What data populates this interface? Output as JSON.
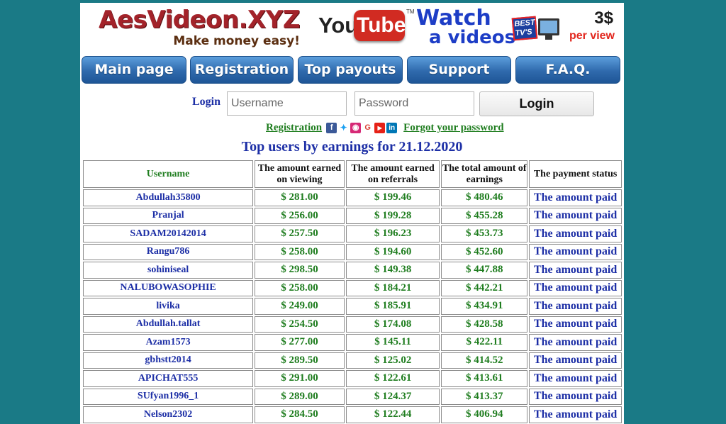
{
  "header": {
    "logo_title": "AesVideon.XYZ",
    "logo_tagline": "Make money easy!",
    "banner": {
      "yt_you": "You",
      "yt_tube": "Tube",
      "yt_tm": "TM",
      "watch_line1": "Watch",
      "watch_line2": "a videos",
      "best_badge": "BEST\nTV'S",
      "price_amount": "3$",
      "price_label": "per view"
    }
  },
  "nav": {
    "items": [
      {
        "label": "Main page"
      },
      {
        "label": "Registration"
      },
      {
        "label": "Top payouts"
      },
      {
        "label": "Support"
      },
      {
        "label": "F.A.Q."
      }
    ]
  },
  "login": {
    "label": "Login",
    "username_placeholder": "Username",
    "password_placeholder": "Password",
    "button_label": "Login",
    "registration_link": "Registration",
    "forgot_link": "Forgot your password",
    "social_icons": [
      "facebook-icon",
      "twitter-icon",
      "instagram-icon",
      "google-icon",
      "youtube-icon",
      "linkedin-icon"
    ]
  },
  "top_title": "Top users by earnings for 21.12.2020",
  "table": {
    "headers": {
      "username": "Username",
      "viewing": "The amount earned on viewing",
      "referrals": "The amount earned on referrals",
      "total": "The total amount of earnings",
      "status": "The payment status"
    },
    "rows": [
      {
        "username": "Abdullah35800",
        "viewing": "$ 281.00",
        "referrals": "$ 199.46",
        "total": "$ 480.46",
        "status": "The amount paid"
      },
      {
        "username": "Pranjal",
        "viewing": "$ 256.00",
        "referrals": "$ 199.28",
        "total": "$ 455.28",
        "status": "The amount paid"
      },
      {
        "username": "SADAM20142014",
        "viewing": "$ 257.50",
        "referrals": "$ 196.23",
        "total": "$ 453.73",
        "status": "The amount paid"
      },
      {
        "username": "Rangu786",
        "viewing": "$ 258.00",
        "referrals": "$ 194.60",
        "total": "$ 452.60",
        "status": "The amount paid"
      },
      {
        "username": "sohiniseal",
        "viewing": "$ 298.50",
        "referrals": "$ 149.38",
        "total": "$ 447.88",
        "status": "The amount paid"
      },
      {
        "username": "NALUBOWASOPHIE",
        "viewing": "$ 258.00",
        "referrals": "$ 184.21",
        "total": "$ 442.21",
        "status": "The amount paid"
      },
      {
        "username": "livika",
        "viewing": "$ 249.00",
        "referrals": "$ 185.91",
        "total": "$ 434.91",
        "status": "The amount paid"
      },
      {
        "username": "Abdullah.tallat",
        "viewing": "$ 254.50",
        "referrals": "$ 174.08",
        "total": "$ 428.58",
        "status": "The amount paid"
      },
      {
        "username": "Azam1573",
        "viewing": "$ 277.00",
        "referrals": "$ 145.11",
        "total": "$ 422.11",
        "status": "The amount paid"
      },
      {
        "username": "gbhstt2014",
        "viewing": "$ 289.50",
        "referrals": "$ 125.02",
        "total": "$ 414.52",
        "status": "The amount paid"
      },
      {
        "username": "APICHAT555",
        "viewing": "$ 291.00",
        "referrals": "$ 122.61",
        "total": "$ 413.61",
        "status": "The amount paid"
      },
      {
        "username": "SUfyan1996_1",
        "viewing": "$ 289.00",
        "referrals": "$ 124.37",
        "total": "$ 413.37",
        "status": "The amount paid"
      },
      {
        "username": "Nelson2302",
        "viewing": "$ 284.50",
        "referrals": "$ 122.44",
        "total": "$ 406.94",
        "status": "The amount paid"
      }
    ]
  },
  "colors": {
    "background": "#1a7a86",
    "nav_button": "#2f6aad",
    "username_text": "#1d2fa6",
    "amount_text": "#1f7d1f",
    "logo_text": "#a3232a"
  }
}
